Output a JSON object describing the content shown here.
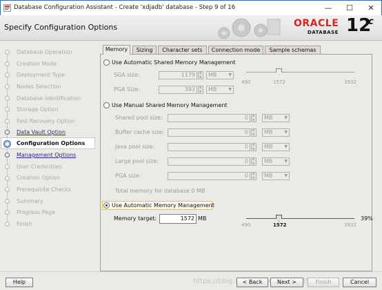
{
  "window": {
    "title": "Database Configuration Assistant - Create 'xdjadb' database - Step 9 of 16",
    "minimize_glyph": "—",
    "maximize_glyph": "☐",
    "close_glyph": "✕"
  },
  "header": {
    "title": "Specify Configuration Options",
    "brand_main": "ORACLE",
    "brand_sub": "DATABASE",
    "version_num": "12",
    "version_suffix": "c"
  },
  "steps": [
    {
      "label": "Database Operation",
      "state": "disabled"
    },
    {
      "label": "Creation Mode",
      "state": "disabled"
    },
    {
      "label": "Deployment Type",
      "state": "disabled"
    },
    {
      "label": "Nodes Selection",
      "state": "disabled"
    },
    {
      "label": "Database Identification",
      "state": "disabled"
    },
    {
      "label": "Storage Option",
      "state": "disabled"
    },
    {
      "label": "Fast Recovery Option",
      "state": "disabled"
    },
    {
      "label": "Data Vault Option",
      "state": "link"
    },
    {
      "label": "Configuration Options",
      "state": "current"
    },
    {
      "label": "Management Options",
      "state": "link"
    },
    {
      "label": "User Credentials",
      "state": "disabled"
    },
    {
      "label": "Creation Option",
      "state": "disabled"
    },
    {
      "label": "Prerequisite Checks",
      "state": "disabled"
    },
    {
      "label": "Summary",
      "state": "disabled"
    },
    {
      "label": "Progress Page",
      "state": "disabled"
    },
    {
      "label": "Finish",
      "state": "disabled"
    }
  ],
  "tabs": [
    {
      "label": "Memory",
      "active": true
    },
    {
      "label": "Sizing",
      "active": false
    },
    {
      "label": "Character sets",
      "active": false
    },
    {
      "label": "Connection mode",
      "active": false
    },
    {
      "label": "Sample schemas",
      "active": false
    }
  ],
  "memory": {
    "asmm": {
      "label": "Use Automatic Shared Memory Management",
      "selected": false,
      "sga_label": "SGA size:",
      "sga_value": "1179",
      "sga_unit": "MB",
      "pga_label": "PGA Size:",
      "pga_value": "393",
      "pga_unit": "MB",
      "slider_min": "490",
      "slider_value": "1572",
      "slider_max": "3932"
    },
    "manual": {
      "label": "Use Manual Shared Memory Management",
      "selected": false,
      "pools": [
        {
          "label": "Shared pool size:",
          "value": "0",
          "unit": "MB"
        },
        {
          "label": "Buffer cache size:",
          "value": "0",
          "unit": "MB"
        },
        {
          "label": "Java pool size:",
          "value": "0",
          "unit": "MB"
        },
        {
          "label": "Large pool size:",
          "value": "0",
          "unit": "MB"
        },
        {
          "label": "PGA size:",
          "value": "0",
          "unit": "MB"
        }
      ],
      "total_label": "Total memory for database 0 MB"
    },
    "amm": {
      "label": "Use Automatic Memory Management",
      "selected": true,
      "target_label": "Memory target:",
      "target_value": "1572",
      "target_unit": "MB",
      "slider_min": "490",
      "slider_value": "1572",
      "slider_max": "3932",
      "percent": "39%"
    }
  },
  "buttons": {
    "help": "Help",
    "back": "< Back",
    "next": "Next >",
    "finish": "Finish",
    "cancel": "Cancel"
  },
  "watermark": "https://blog.csdn.net/weixin_41854226"
}
